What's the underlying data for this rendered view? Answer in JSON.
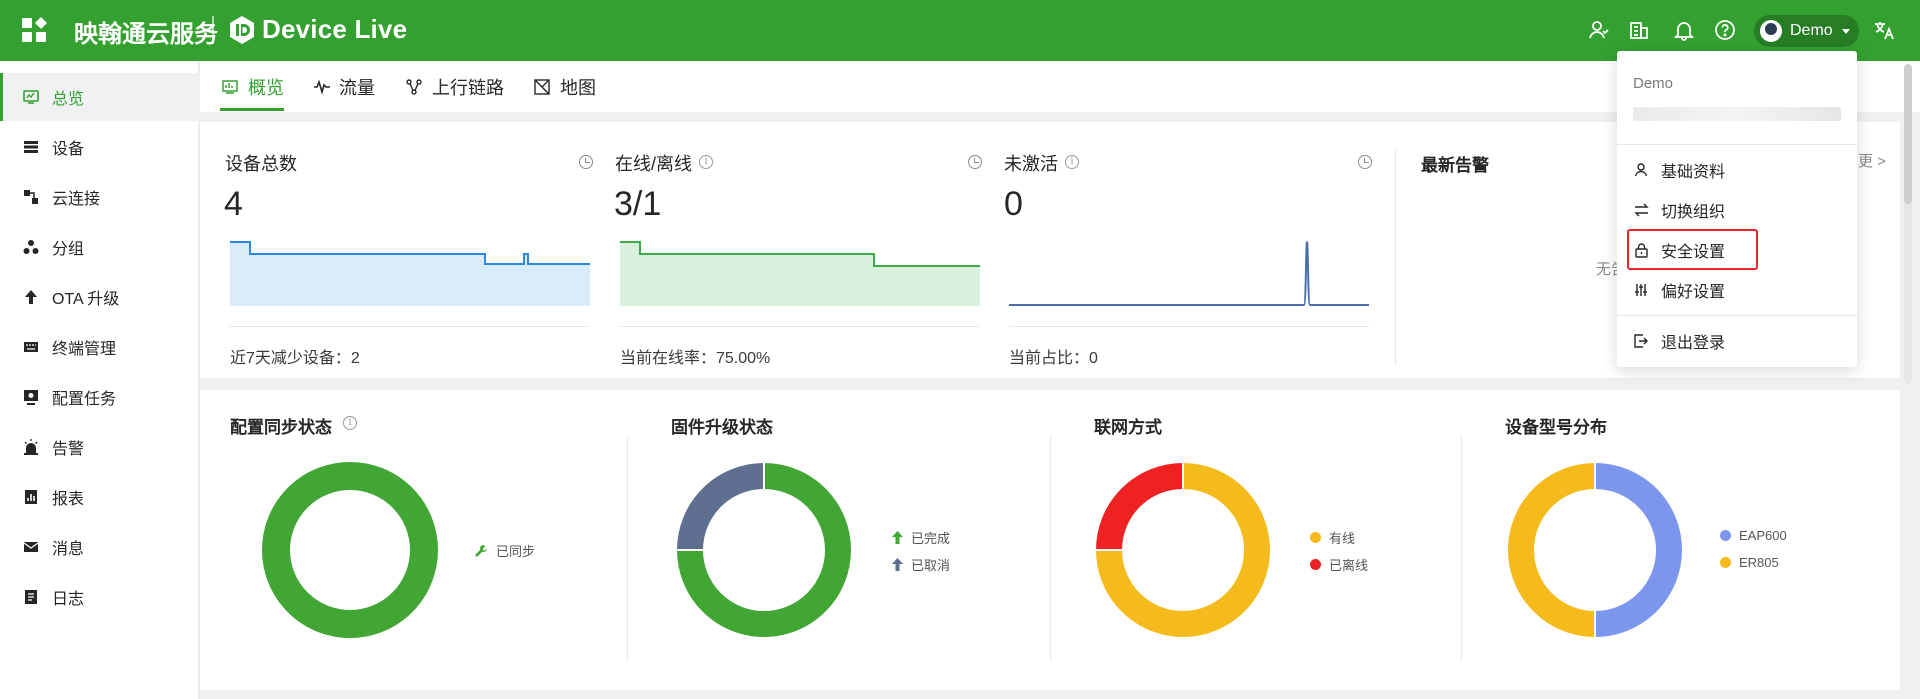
{
  "header": {
    "brand": "映翰通云服务",
    "product": "Device Live",
    "user_name": "Demo"
  },
  "sidebar": {
    "items": [
      {
        "label": "总览",
        "icon": "dashboard-icon"
      },
      {
        "label": "设备",
        "icon": "server-icon"
      },
      {
        "label": "云连接",
        "icon": "cloud-connect-icon"
      },
      {
        "label": "分组",
        "icon": "group-icon"
      },
      {
        "label": "OTA 升级",
        "icon": "upgrade-icon"
      },
      {
        "label": "终端管理",
        "icon": "keyboard-icon"
      },
      {
        "label": "配置任务",
        "icon": "config-task-icon"
      },
      {
        "label": "告警",
        "icon": "alarm-icon"
      },
      {
        "label": "报表",
        "icon": "report-icon"
      },
      {
        "label": "消息",
        "icon": "mail-icon"
      },
      {
        "label": "日志",
        "icon": "log-icon"
      }
    ]
  },
  "tabs": [
    {
      "label": "概览",
      "icon": "overview-icon"
    },
    {
      "label": "流量",
      "icon": "pulse-icon"
    },
    {
      "label": "上行链路",
      "icon": "uplink-icon"
    },
    {
      "label": "地图",
      "icon": "map-icon"
    }
  ],
  "stats": {
    "total": {
      "title": "设备总数",
      "value": "4",
      "footer": "近7天减少设备：2"
    },
    "online": {
      "title": "在线/离线",
      "value": "3/1",
      "footer": "当前在线率：75.00%"
    },
    "inactive": {
      "title": "未激活",
      "value": "0",
      "footer": "当前占比：0"
    },
    "alerts_title": "最新告警",
    "alerts_partial": "无告",
    "alerts_more": "更 >"
  },
  "sections": {
    "config_sync": {
      "title": "配置同步状态",
      "legend": [
        "已同步"
      ]
    },
    "firmware": {
      "title": "固件升级状态",
      "legend": [
        "已完成",
        "已取消"
      ]
    },
    "network": {
      "title": "联网方式",
      "legend": [
        "有线",
        "已离线"
      ]
    },
    "model": {
      "title": "设备型号分布",
      "legend": [
        "EAP600",
        "ER805"
      ]
    }
  },
  "dropdown": {
    "name": "Demo",
    "items": [
      {
        "label": "基础资料",
        "icon": "user-icon"
      },
      {
        "label": "切换组织",
        "icon": "switch-icon"
      },
      {
        "label": "安全设置",
        "icon": "lock-icon"
      },
      {
        "label": "偏好设置",
        "icon": "sliders-icon"
      },
      {
        "label": "退出登录",
        "icon": "logout-icon"
      }
    ]
  },
  "colors": {
    "brand_green": "#33a030",
    "donut_green": "#41a634",
    "donut_slate": "#5f6f8f",
    "donut_red": "#ee2222",
    "donut_yellow": "#f5bb1d",
    "donut_blue": "#7b96ec"
  },
  "chart_data": [
    {
      "type": "pie",
      "title": "配置同步状态",
      "categories": [
        "已同步"
      ],
      "values": [
        1
      ]
    },
    {
      "type": "pie",
      "title": "固件升级状态",
      "categories": [
        "已完成",
        "已取消"
      ],
      "values": [
        0.75,
        0.25
      ]
    },
    {
      "type": "pie",
      "title": "联网方式",
      "categories": [
        "有线",
        "已离线"
      ],
      "values": [
        0.75,
        0.25
      ]
    },
    {
      "type": "pie",
      "title": "设备型号分布",
      "categories": [
        "EAP600",
        "ER805"
      ],
      "values": [
        0.5,
        0.5
      ]
    }
  ]
}
